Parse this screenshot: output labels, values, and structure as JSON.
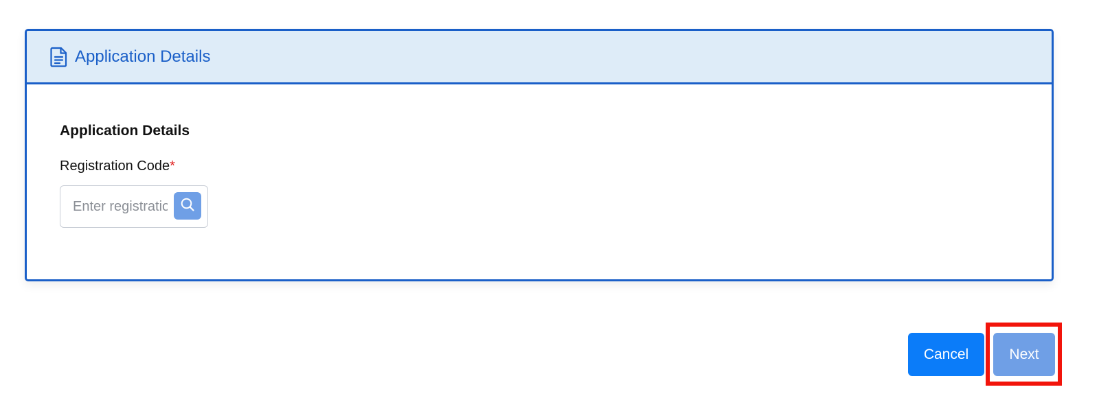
{
  "card": {
    "header_title": "Application Details",
    "header_icon": "document-icon"
  },
  "form": {
    "section_heading": "Application Details",
    "registration_label": "Registration Code",
    "required_mark": "*",
    "registration_placeholder": "Enter registration code",
    "registration_value": "",
    "search_icon": "search-icon"
  },
  "actions": {
    "cancel_label": "Cancel",
    "next_label": "Next"
  },
  "colors": {
    "accent": "#1a5fc8",
    "header_bg": "#deecf8",
    "cancel_bg": "#0b7cf9",
    "next_bg": "#6f9fe6",
    "highlight": "#f2140b",
    "required": "#e0201f"
  }
}
